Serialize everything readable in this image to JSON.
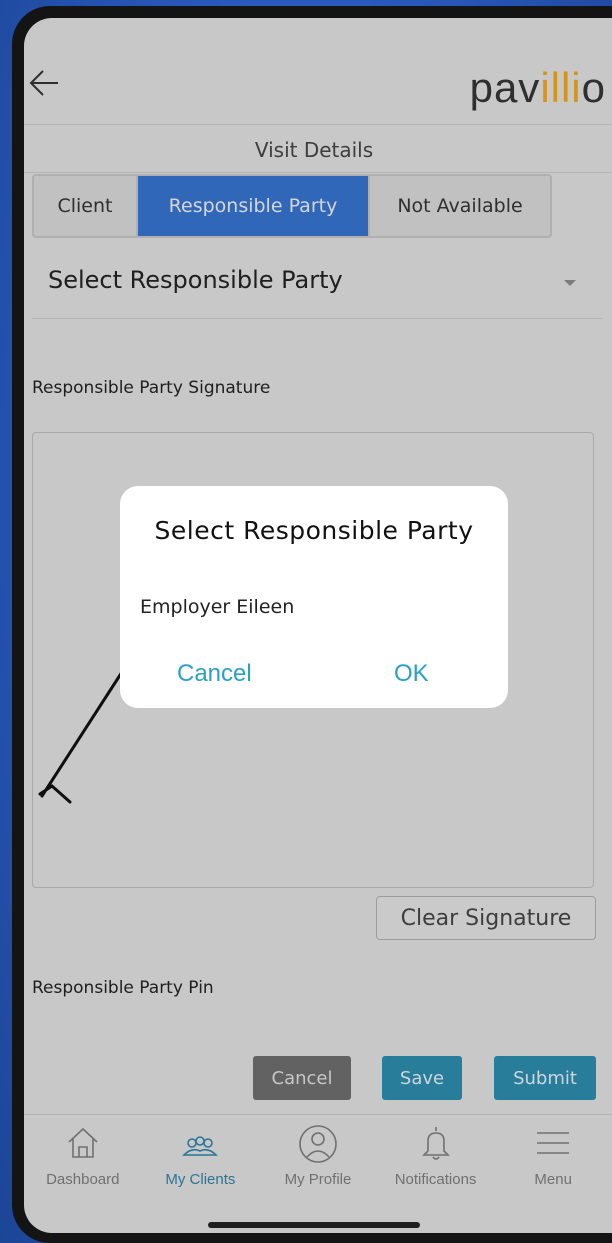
{
  "header": {
    "logo_text_start": "pav",
    "logo_text_accent": "illi",
    "logo_text_end": "o"
  },
  "page_title": "Visit Details",
  "tabs": [
    {
      "label": "Client",
      "active": false
    },
    {
      "label": "Responsible Party",
      "active": true
    },
    {
      "label": "Not Available",
      "active": false
    }
  ],
  "select": {
    "value": "Select Responsible Party"
  },
  "signature": {
    "label": "Responsible Party Signature",
    "clear_label": "Clear Signature"
  },
  "pin": {
    "label": "Responsible Party Pin"
  },
  "actions": {
    "cancel": "Cancel",
    "save": "Save",
    "submit": "Submit"
  },
  "nav": {
    "items": [
      {
        "label": "Dashboard",
        "icon": "home-icon"
      },
      {
        "label": "My Clients",
        "icon": "clients-icon",
        "active": true
      },
      {
        "label": "My Profile",
        "icon": "profile-icon"
      },
      {
        "label": "Notifications",
        "icon": "bell-icon"
      },
      {
        "label": "Menu",
        "icon": "menu-icon"
      }
    ]
  },
  "modal": {
    "title": "Select Responsible Party",
    "option": "Employer Eileen",
    "cancel": "Cancel",
    "ok": "OK"
  },
  "colors": {
    "accent": "#3570c9",
    "teal": "#2b88a8",
    "logo_accent": "#e6a21c"
  }
}
